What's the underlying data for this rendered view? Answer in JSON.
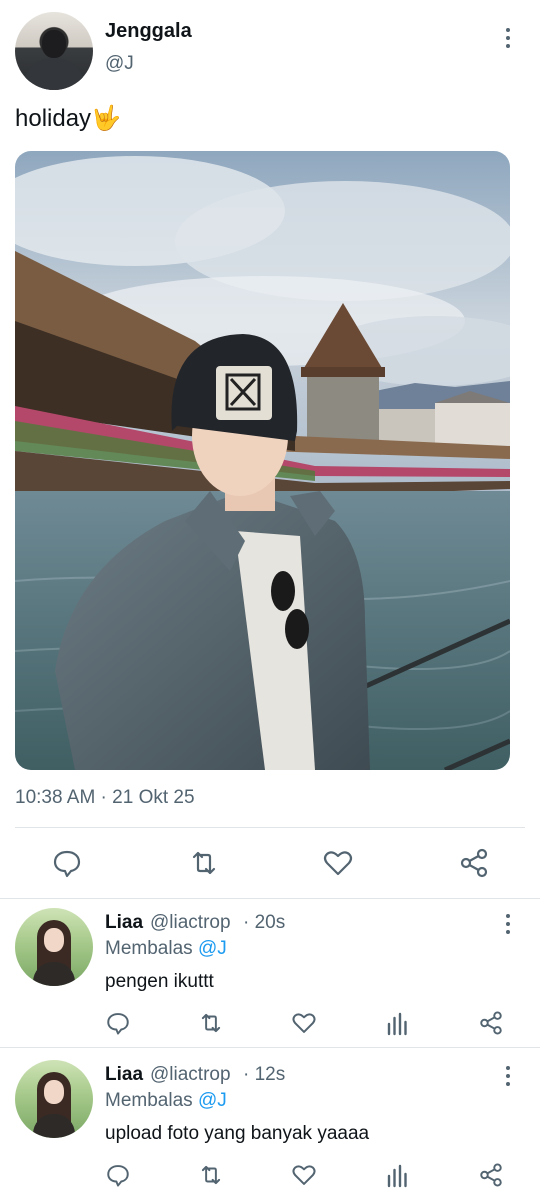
{
  "tweet": {
    "author_name": "Jenggala",
    "author_handle": "@J",
    "text": "holiday",
    "emoji": "🤟",
    "timestamp": "10:38 AM · 21 Okt 25",
    "actions": [
      "reply-icon",
      "retweet-icon",
      "like-icon",
      "share-icon"
    ]
  },
  "replies": [
    {
      "name": "Liaa",
      "handle": "@liactrop",
      "time": "· 20s",
      "replying_label": "Membalas",
      "replying_to": "@J",
      "text": "pengen ikuttt"
    },
    {
      "name": "Liaa",
      "handle": "@liactrop",
      "time": "· 12s",
      "replying_label": "Membalas",
      "replying_to": "@J",
      "text": "upload foto yang banyak yaaaa"
    }
  ],
  "colors": {
    "text": "#0f1419",
    "secondary": "#536471",
    "accent": "#1d9bf0",
    "divider": "#e1e5e8"
  }
}
